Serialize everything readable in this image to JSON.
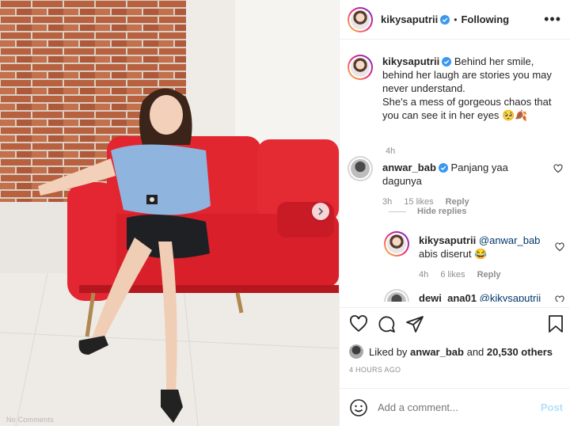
{
  "post": {
    "username": "kikysaputrii",
    "follow_status": "Following",
    "separator": "•",
    "more_label": "•••",
    "image_alt_text": "No Comments"
  },
  "caption": {
    "username": "kikysaputrii",
    "line1": "Behind her smile, behind her laugh are stories you may never understand.",
    "line2": "She's a mess of gorgeous chaos that you can see it in her eyes 🥺🍂",
    "time": "4h"
  },
  "comments": [
    {
      "username": "anwar_bab",
      "text": "Panjang yaa dagunya",
      "time": "3h",
      "likes": "15 likes",
      "reply_label": "Reply"
    }
  ],
  "hide_replies_label": "Hide replies",
  "replies": [
    {
      "username": "kikysaputrii",
      "mention": "@anwar_bab",
      "text": "abis diserut 😂",
      "time": "4h",
      "likes": "6 likes",
      "reply_label": "Reply"
    },
    {
      "username": "dewi_ana01",
      "mention": "@kikysaputrii"
    }
  ],
  "likes_summary": {
    "prefix": "Liked by",
    "user": "anwar_bab",
    "connector": "and",
    "others": "20,530 others"
  },
  "time_ago": "4 HOURS AGO",
  "add_comment": {
    "placeholder": "Add a comment...",
    "post_label": "Post"
  },
  "colors": {
    "verified": "#3897f0",
    "link": "#00376b",
    "post_disabled": "#b2dffc"
  },
  "icons": [
    "verified-badge-icon",
    "more-options-icon",
    "heart-icon",
    "comment-icon",
    "share-icon",
    "bookmark-icon",
    "emoji-icon",
    "chevron-right-icon"
  ]
}
